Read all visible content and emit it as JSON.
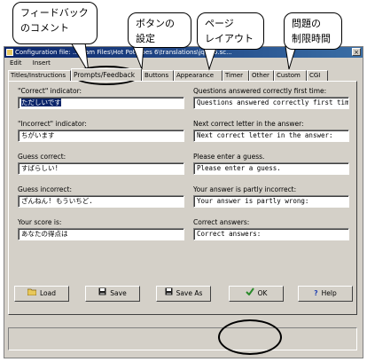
{
  "window": {
    "title": "Configuration file: ...gram Files\\Hot Potatoes 6\\translations\\jquiz6.sc...",
    "close_glyph": "×"
  },
  "menu": [
    "Edit",
    "Insert"
  ],
  "tabs": [
    "Titles/Instructions",
    "Prompts/Feedback",
    "Buttons",
    "Appearance",
    "Timer",
    "Other",
    "Custom",
    "CGI"
  ],
  "fields_left": [
    {
      "label": "\"Correct\" indicator:",
      "value": "ただしいです"
    },
    {
      "label": "\"Incorrect\" indicator:",
      "value": "ちがいます"
    },
    {
      "label": "Guess correct:",
      "value": "すばらしい!"
    },
    {
      "label": "Guess incorrect:",
      "value": "ざんねん! もういちど."
    },
    {
      "label": "Your score is:",
      "value": "あなたの得点は"
    }
  ],
  "fields_right": [
    {
      "label": "Questions answered correctly first time:",
      "value": "Questions answered correctly first tim"
    },
    {
      "label": "Next correct letter in the answer:",
      "value": "Next correct letter in the answer:"
    },
    {
      "label": "Please enter a guess.",
      "value": "Please enter a guess."
    },
    {
      "label": "Your answer is partly incorrect:",
      "value": "Your answer is partly wrong:"
    },
    {
      "label": "Correct answers:",
      "value": "Correct answers:"
    }
  ],
  "buttons": [
    {
      "label": "Load",
      "icon": "folder-icon"
    },
    {
      "label": "Save",
      "icon": "floppy-icon"
    },
    {
      "label": "Save As",
      "icon": "floppy-icon"
    },
    {
      "label": "OK",
      "icon": "checkmark-icon"
    },
    {
      "label": "Help",
      "icon": "question-icon"
    }
  ],
  "callouts": [
    {
      "line1": "フィードバック",
      "line2": "のコメント"
    },
    {
      "line1": "ボタンの",
      "line2": "設定"
    },
    {
      "line1": "ページ",
      "line2": "レイアウト"
    },
    {
      "line1": "問題の",
      "line2": "制限時間"
    }
  ],
  "colors": {
    "titlebar": "#0a246a",
    "face": "#d4d0c8",
    "selection": "#0a246a",
    "ok_check": "#2a8a2a",
    "help_icon": "#1f3fb0"
  }
}
